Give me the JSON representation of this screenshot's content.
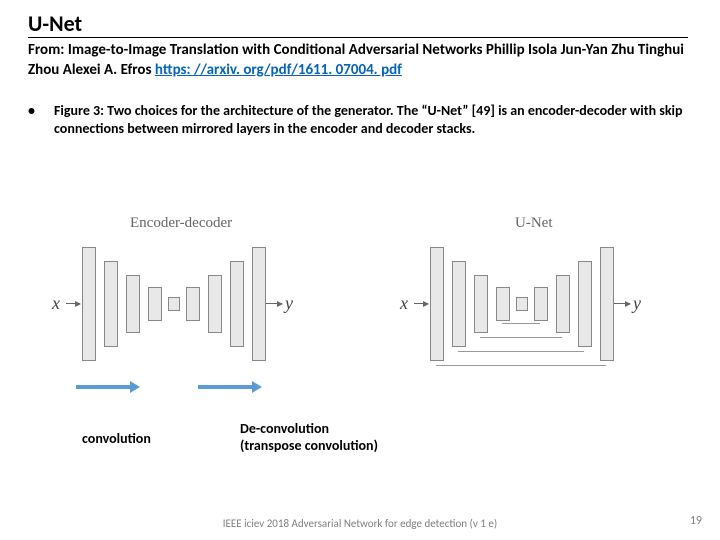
{
  "title": "U-Net",
  "subtitle_prefix": "From: Image-to-Image Translation with Conditional Adversarial Networks Phillip Isola Jun-Yan Zhu Tinghui Zhou Alexei A. Efros ",
  "subtitle_link": "https: //arxiv. org/pdf/1611. 07004. pdf",
  "bullet": "Figure 3: Two choices for the architecture of the generator. The “U-Net” [49] is an encoder-decoder with skip connections between mirrored layers in the encoder and decoder stacks.",
  "diag_left_title": "Encoder-decoder",
  "diag_right_title": "U-Net",
  "x": "x",
  "y": "y",
  "ann_conv": "convolution",
  "ann_deconv": "De-convolution (transpose convolution)",
  "footer": "IEEE iciev 2018 Adversarial Network for edge detection (v 1 e)",
  "page": "19"
}
